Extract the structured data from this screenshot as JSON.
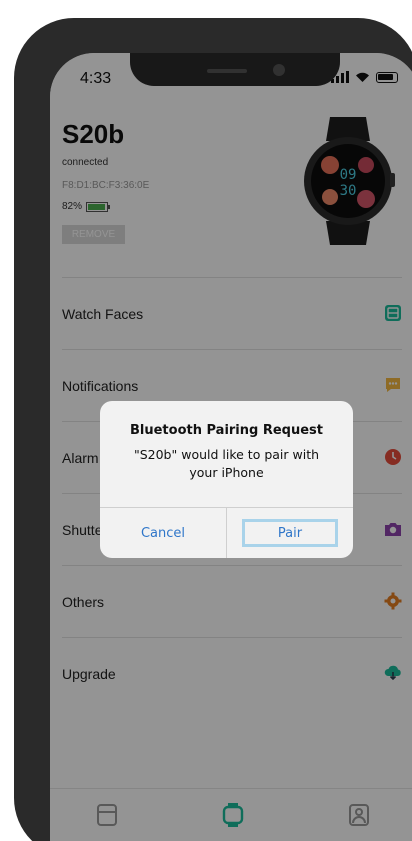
{
  "status_bar": {
    "time": "4:33"
  },
  "device": {
    "name": "S20b",
    "status": "connected",
    "mac": "F8:D1:BC:F3:36:0E",
    "battery": "82%",
    "battery_level": 0.82,
    "remove_label": "REMOVE"
  },
  "watch_face": {
    "time_top": "09",
    "time_bottom": "30"
  },
  "menu": [
    {
      "label": "Watch Faces",
      "icon": "watch-faces-icon",
      "color": "#1abc9c"
    },
    {
      "label": "Notifications",
      "icon": "notifications-icon",
      "color": "#f5b942"
    },
    {
      "label": "Alarm",
      "icon": "alarm-icon",
      "color": "#e74c3c"
    },
    {
      "label": "Shutter",
      "icon": "camera-icon",
      "color": "#8e44ad"
    },
    {
      "label": "Others",
      "icon": "gear-icon",
      "color": "#e67e22"
    },
    {
      "label": "Upgrade",
      "icon": "cloud-download-icon",
      "color": "#1abc9c"
    }
  ],
  "dialog": {
    "title": "Bluetooth Pairing Request",
    "message": "\"S20b\" would like to pair with your iPhone",
    "cancel_label": "Cancel",
    "pair_label": "Pair",
    "button_color": "#2f76c9"
  },
  "tabs": [
    {
      "icon": "list-icon"
    },
    {
      "icon": "watch-icon",
      "active": true,
      "color": "#1abc9c"
    },
    {
      "icon": "profile-icon"
    }
  ]
}
